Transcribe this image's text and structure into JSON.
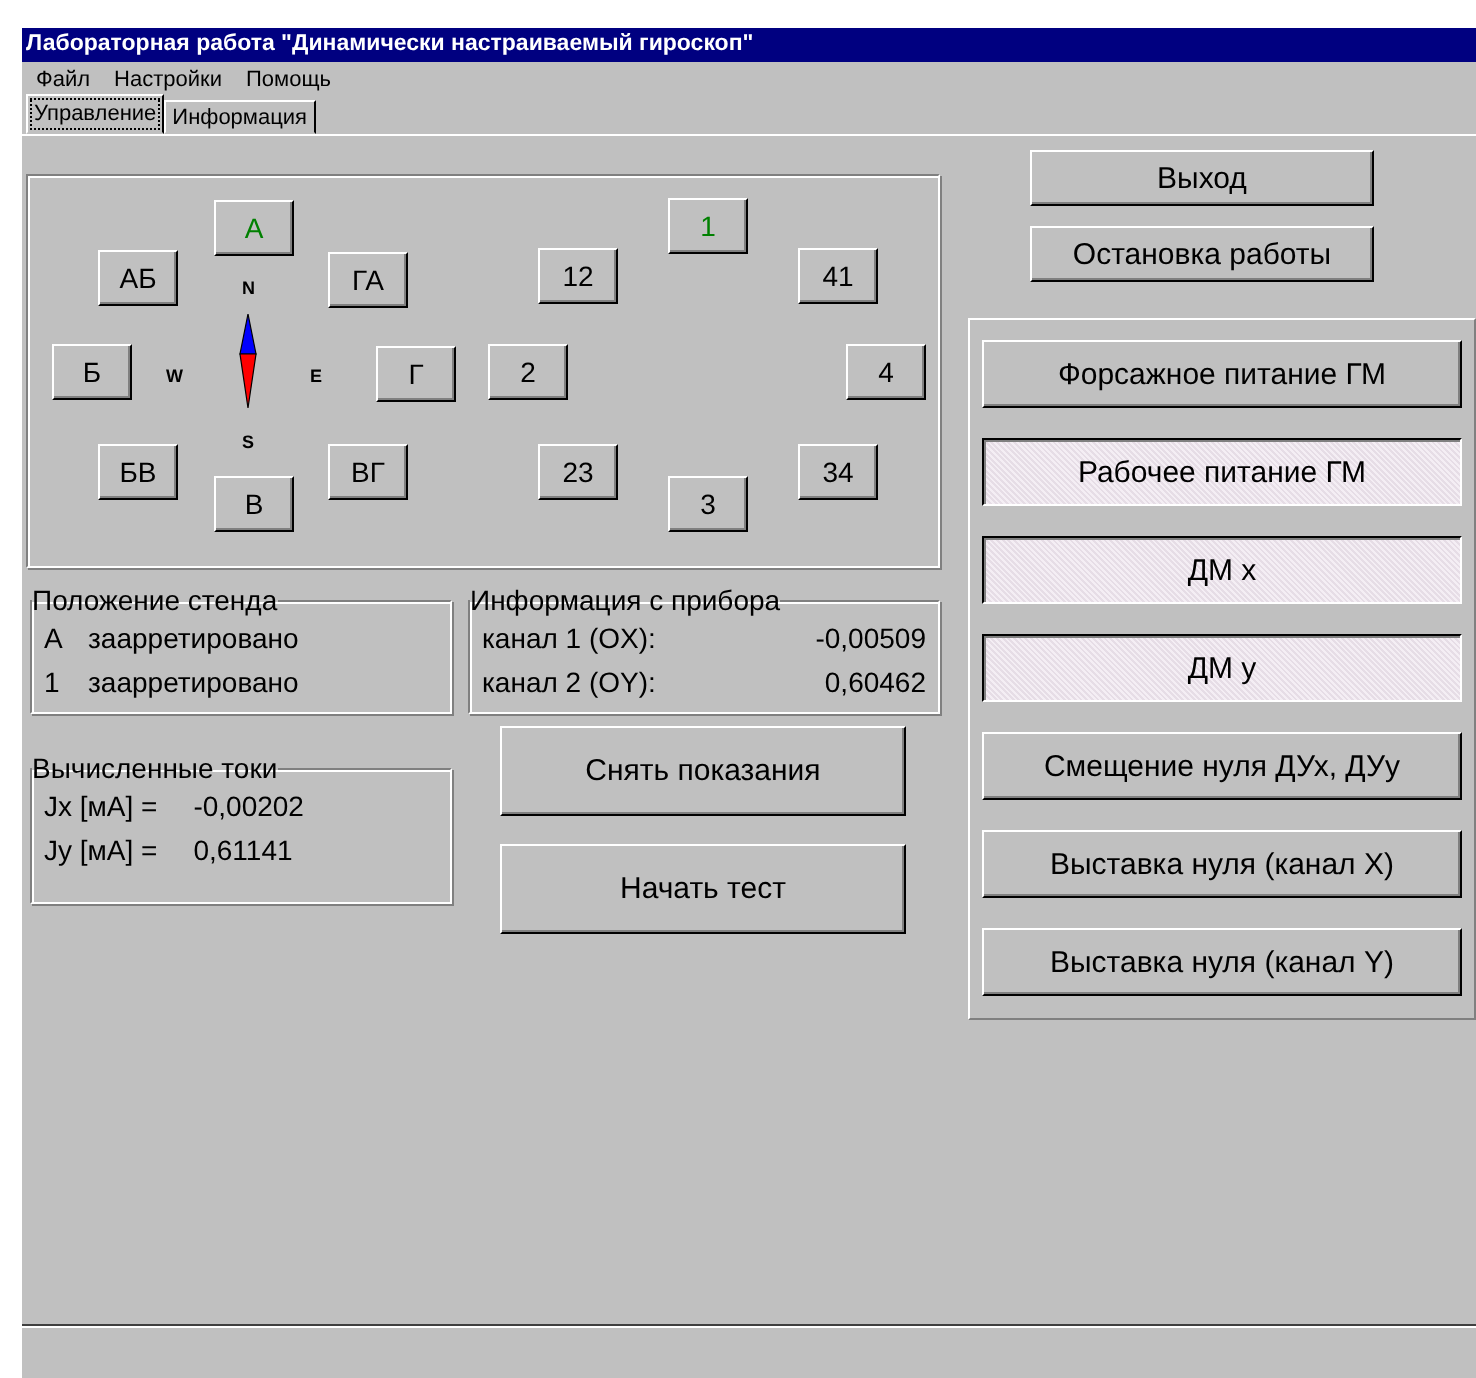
{
  "window": {
    "title": "Лабораторная работа \"Динамически настраиваемый гироскоп\""
  },
  "menu": [
    {
      "label": "Файл"
    },
    {
      "label": "Настройки"
    },
    {
      "label": "Помощь"
    }
  ],
  "tabs": [
    {
      "label": "Управление",
      "selected": true
    },
    {
      "label": "Информация",
      "selected": false
    }
  ],
  "compass": {
    "north": "N",
    "west": "W",
    "east": "E",
    "south": "S"
  },
  "letter_positions": [
    {
      "label": "А",
      "selected": true
    },
    {
      "label": "АБ",
      "selected": false
    },
    {
      "label": "ГА",
      "selected": false
    },
    {
      "label": "Б",
      "selected": false
    },
    {
      "label": "Г",
      "selected": false
    },
    {
      "label": "БВ",
      "selected": false
    },
    {
      "label": "ВГ",
      "selected": false
    },
    {
      "label": "В",
      "selected": false
    }
  ],
  "number_positions": [
    {
      "label": "1",
      "selected": true
    },
    {
      "label": "12",
      "selected": false
    },
    {
      "label": "41",
      "selected": false
    },
    {
      "label": "2",
      "selected": false
    },
    {
      "label": "4",
      "selected": false
    },
    {
      "label": "23",
      "selected": false
    },
    {
      "label": "34",
      "selected": false
    },
    {
      "label": "3",
      "selected": false
    }
  ],
  "stand_position": {
    "title": "Положение стенда",
    "rows": [
      {
        "name": "А",
        "state": "заарретировано"
      },
      {
        "name": "1",
        "state": "заарретировано"
      }
    ]
  },
  "device_info": {
    "title": "Информация с прибора",
    "rows": [
      {
        "label": "канал 1 (OX):",
        "value": "-0,00509"
      },
      {
        "label": "канал 2 (OY):",
        "value": "0,60462"
      }
    ]
  },
  "currents": {
    "title": "Вычисленные токи",
    "rows": [
      {
        "label": "Jx [мА] =",
        "value": "-0,00202"
      },
      {
        "label": "Jy [мА] =",
        "value": "0,61141"
      }
    ]
  },
  "action_buttons": [
    {
      "label": "Снять показания"
    },
    {
      "label": "Начать тест"
    }
  ],
  "top_buttons": [
    {
      "label": "Выход"
    },
    {
      "label": "Остановка работы"
    }
  ],
  "mode_buttons": [
    {
      "label": "Форсажное питание ГМ",
      "pressed": false
    },
    {
      "label": "Рабочее питание ГМ",
      "pressed": true
    },
    {
      "label": "ДМ x",
      "pressed": true
    },
    {
      "label": "ДМ y",
      "pressed": true
    },
    {
      "label": "Смещение нуля ДУх, ДУу",
      "pressed": false
    },
    {
      "label": "Выставка нуля (канал X)",
      "pressed": false
    },
    {
      "label": "Выставка нуля (канал Y)",
      "pressed": false
    }
  ]
}
